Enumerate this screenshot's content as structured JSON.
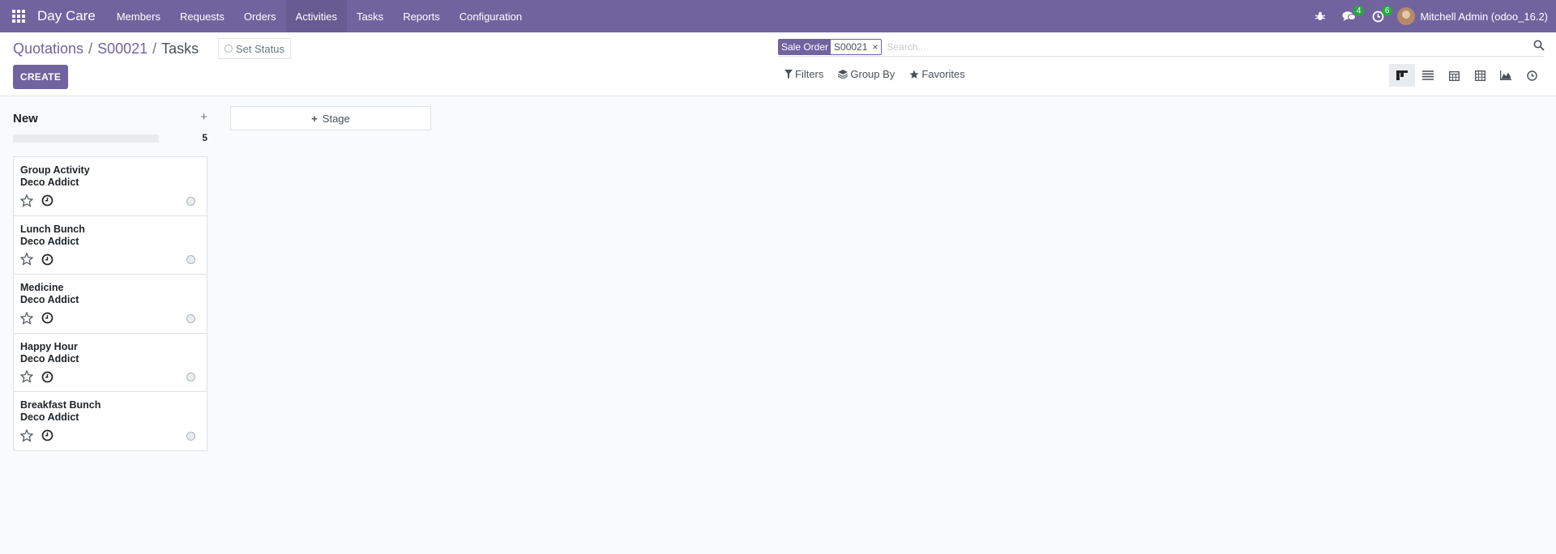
{
  "navbar": {
    "brand": "Day Care",
    "menu": [
      {
        "label": "Members"
      },
      {
        "label": "Requests"
      },
      {
        "label": "Orders"
      },
      {
        "label": "Activities"
      },
      {
        "label": "Tasks"
      },
      {
        "label": "Reports"
      },
      {
        "label": "Configuration"
      }
    ],
    "active_menu": "Activities",
    "messages_count": "4",
    "activities_count": "6",
    "user_name": "Mitchell Admin (odoo_16.2)"
  },
  "breadcrumb": {
    "items": [
      "Quotations",
      "S00021",
      "Tasks"
    ],
    "separator": "/"
  },
  "set_status_label": "Set Status",
  "create_label": "CREATE",
  "search": {
    "facet_label": "Sale Order",
    "facet_value": "S00021",
    "placeholder": "Search..."
  },
  "filters": {
    "filters_label": "Filters",
    "group_by_label": "Group By",
    "favorites_label": "Favorites"
  },
  "views": [
    "kanban-icon",
    "list-icon",
    "calendar-icon",
    "pivot-icon",
    "graph-icon",
    "activity-icon"
  ],
  "kanban": {
    "column_title": "New",
    "count": "5",
    "cards": [
      {
        "title": "Group Activity",
        "customer": "Deco Addict"
      },
      {
        "title": "Lunch Bunch",
        "customer": "Deco Addict"
      },
      {
        "title": "Medicine",
        "customer": "Deco Addict"
      },
      {
        "title": "Happy Hour",
        "customer": "Deco Addict"
      },
      {
        "title": "Breakfast Bunch",
        "customer": "Deco Addict"
      }
    ],
    "add_stage_label": "Stage"
  },
  "colors": {
    "brand": "#71639e",
    "badge": "#28a745"
  }
}
